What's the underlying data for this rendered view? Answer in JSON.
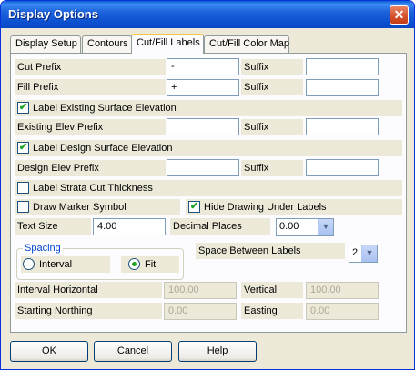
{
  "window": {
    "title": "Display Options",
    "close_glyph": "✕"
  },
  "tabs": [
    {
      "label": "Display Setup"
    },
    {
      "label": "Contours"
    },
    {
      "label": "Cut/Fill Labels"
    },
    {
      "label": "Cut/Fill Color Map"
    }
  ],
  "form": {
    "cut_prefix": {
      "label": "Cut Prefix",
      "value": "-",
      "suffix_label": "Suffix",
      "suffix_value": ""
    },
    "fill_prefix": {
      "label": "Fill Prefix",
      "value": "+",
      "suffix_label": "Suffix",
      "suffix_value": ""
    },
    "label_existing": {
      "label": "Label Existing Surface Elevation",
      "checked": true
    },
    "existing_prefix": {
      "label": "Existing Elev Prefix",
      "value": "",
      "suffix_label": "Suffix",
      "suffix_value": ""
    },
    "label_design": {
      "label": "Label Design Surface Elevation",
      "checked": true
    },
    "design_prefix": {
      "label": "Design Elev Prefix",
      "value": "",
      "suffix_label": "Suffix",
      "suffix_value": ""
    },
    "label_strata": {
      "label": "Label Strata Cut Thickness",
      "checked": false
    },
    "draw_marker": {
      "label": "Draw Marker Symbol",
      "checked": false
    },
    "hide_drawing": {
      "label": "Hide Drawing Under Labels",
      "checked": true
    },
    "text_size": {
      "label": "Text Size",
      "value": "4.00"
    },
    "decimal_places": {
      "label": "Decimal Places",
      "value": "0.00"
    },
    "spacing": {
      "title": "Spacing",
      "interval_label": "Interval",
      "fit_label": "Fit",
      "selected": "Fit"
    },
    "space_between": {
      "label": "Space Between Labels",
      "value": "2"
    },
    "interval_horizontal": {
      "label": "Interval Horizontal",
      "value": "100.00"
    },
    "vertical": {
      "label": "Vertical",
      "value": "100.00"
    },
    "starting_northing": {
      "label": "Starting Northing",
      "value": "0.00"
    },
    "easting": {
      "label": "Easting",
      "value": "0.00"
    }
  },
  "buttons": {
    "ok": "OK",
    "cancel": "Cancel",
    "help": "Help"
  },
  "colors": {
    "accent_check": "#21a121",
    "title_bar": "#0b4fd0",
    "group_title": "#0046d5"
  }
}
